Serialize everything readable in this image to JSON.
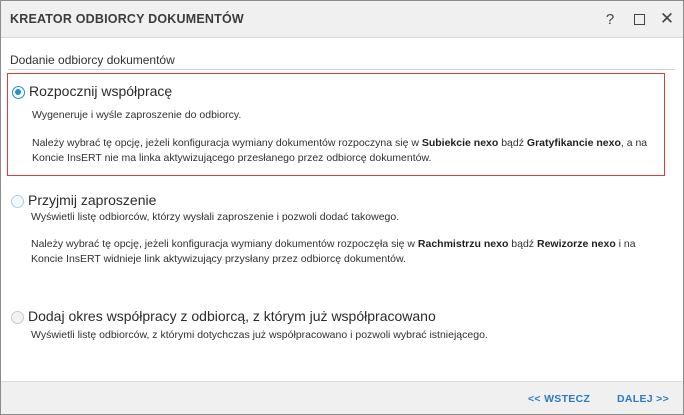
{
  "window": {
    "title": "KREATOR ODBIORCY DOKUMENTÓW",
    "help_glyph": "?",
    "close_glyph": "✕"
  },
  "section": {
    "label": "Dodanie odbiorcy dokumentów"
  },
  "options": [
    {
      "title": "Rozpocznij współpracę",
      "selected": true,
      "desc": "Wygeneruje i wyśle zaproszenie do odbiorcy.",
      "text_parts": [
        "Należy wybrać tę opcję, jeżeli konfiguracja wymiany dokumentów rozpoczyna się w ",
        "Subiekcie nexo",
        " bądź ",
        "Gratyfikancie nexo",
        ", a na Koncie InsERT nie ma linka aktywizującego przesłanego przez odbiorcę dokumentów."
      ]
    },
    {
      "title": "Przyjmij zaproszenie",
      "selected": false,
      "desc": "Wyświetli listę odbiorców, którzy wysłali zaproszenie i pozwoli dodać takowego.",
      "text_parts": [
        "Należy wybrać tę opcję, jeżeli konfiguracja wymiany dokumentów rozpoczęła się w ",
        "Rachmistrzu nexo",
        " bądź ",
        "Rewizorze nexo",
        " i na Koncie InsERT widnieje link aktywizujący przysłany przez odbiorcę dokumentów."
      ]
    },
    {
      "title": "Dodaj okres współpracy z odbiorcą, z którym już współpracowano",
      "selected": false,
      "desc": "Wyświetli listę odbiorców, z którymi dotychczas już współpracowano i pozwoli wybrać istniejącego."
    }
  ],
  "footer": {
    "back_label": "<< WSTECZ",
    "next_label": "DALEJ >>"
  },
  "colors": {
    "accent": "#1e90d8",
    "selection_border": "#e33a3a",
    "link": "#2a7ac6"
  }
}
